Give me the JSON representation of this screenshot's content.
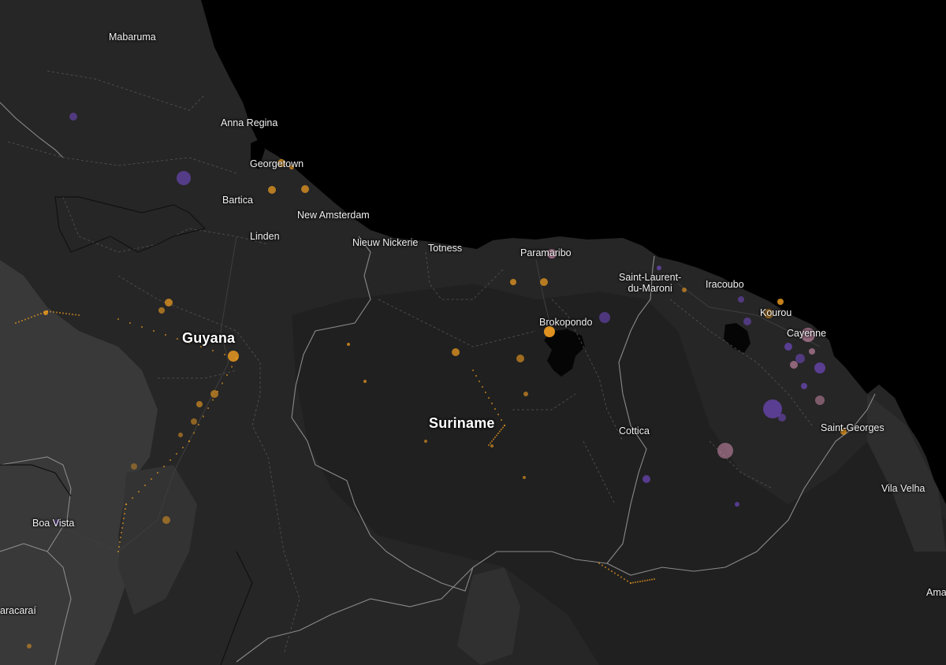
{
  "map": {
    "colors": {
      "ocean": "#000000",
      "land": "#262626",
      "land_dark": "#1d1d1d",
      "land_light": "#363636",
      "border": "#8a8a8a",
      "admin_border": "#4a4a4a",
      "road": "#3c3c3c",
      "point_orange": "#f5a020",
      "point_purple": "#7b4ed8",
      "point_pink": "#d48fb0",
      "label": "#f2f2f2"
    },
    "places": [
      {
        "id": "mabaruma",
        "name": "Mabaruma"
      },
      {
        "id": "anna-regina",
        "name": "Anna Regina"
      },
      {
        "id": "georgetown",
        "name": "Georgetown"
      },
      {
        "id": "bartica",
        "name": "Bartica"
      },
      {
        "id": "new-amsterdam",
        "name": "New Amsterdam"
      },
      {
        "id": "linden",
        "name": "Linden"
      },
      {
        "id": "nieuw-nickerie",
        "name": "Nieuw Nickerie"
      },
      {
        "id": "totness",
        "name": "Totness"
      },
      {
        "id": "paramaribo",
        "name": "Paramaribo"
      },
      {
        "id": "saint-laurent",
        "name": "Saint-Laurent-\ndu-Maroni"
      },
      {
        "id": "iracoubo",
        "name": "Iracoubo"
      },
      {
        "id": "kourou",
        "name": "Kourou"
      },
      {
        "id": "cayenne",
        "name": "Cayenne"
      },
      {
        "id": "brokopondo",
        "name": "Brokopondo"
      },
      {
        "id": "cottica",
        "name": "Cottica"
      },
      {
        "id": "saint-georges",
        "name": "Saint-Georges"
      },
      {
        "id": "vila-velha",
        "name": "Vila Velha"
      },
      {
        "id": "boa-vista",
        "name": "Boa Vista"
      },
      {
        "id": "caracarai",
        "name": "aracaraí"
      },
      {
        "id": "amapa-partial",
        "name": "Ama"
      }
    ],
    "countries": [
      {
        "id": "guyana",
        "name": "Guyana"
      },
      {
        "id": "suriname",
        "name": "Suriname"
      }
    ]
  }
}
